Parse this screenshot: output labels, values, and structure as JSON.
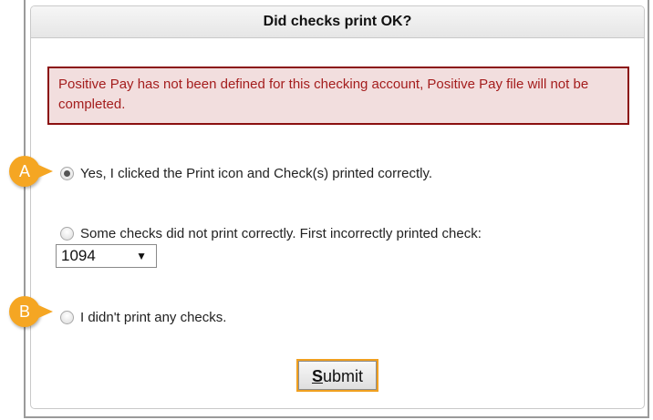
{
  "dialog": {
    "title": "Did checks print OK?",
    "alert": "Positive Pay has not been defined for this checking account, Positive Pay file will not be completed."
  },
  "options": [
    {
      "label": "Yes, I clicked the Print icon and Check(s) printed correctly.",
      "checked": true
    },
    {
      "label": "Some checks did not print correctly. First incorrectly printed check:",
      "checked": false
    },
    {
      "label": "I didn't print any checks.",
      "checked": false
    }
  ],
  "check_select": {
    "value": "1094"
  },
  "submit": {
    "label_first": "S",
    "label_rest": "ubmit"
  },
  "markers": [
    "A",
    "B"
  ],
  "colors": {
    "alert_border": "#8b1010",
    "alert_bg": "#f2dede",
    "marker": "#f5a623",
    "focus": "#f0a020"
  }
}
